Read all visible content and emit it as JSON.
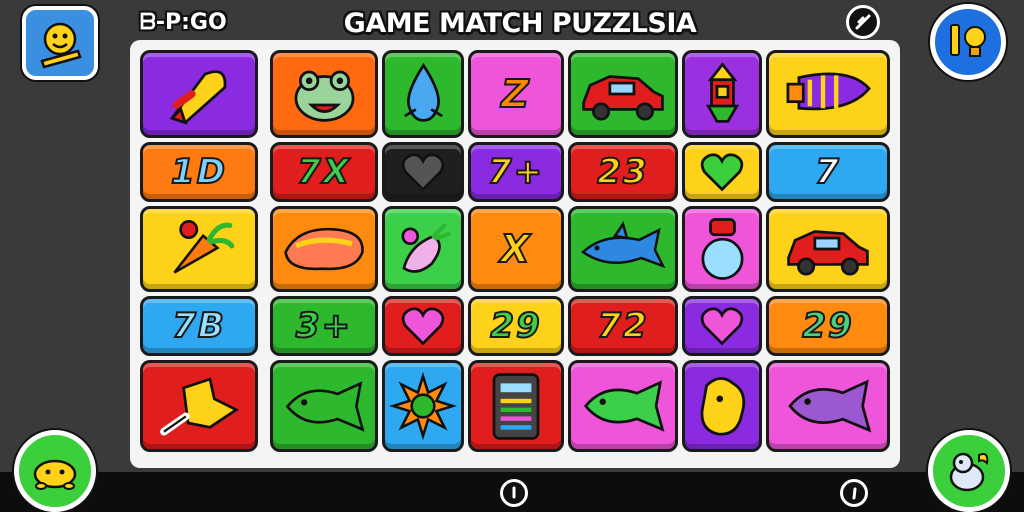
{
  "header": {
    "title": "GAME MATCH PUZZLSIA",
    "timer": "ᗷ-P:GO"
  },
  "buttons": {
    "avatar": "avatar-icon",
    "close": "close-icon",
    "hint": "lightbulb-hint-icon",
    "bottom_left": "turtle-icon",
    "bottom_right": "bird-icon"
  },
  "bottom_bar": {
    "left_indicator": "info-icon",
    "right_indicator": "info-icon"
  },
  "colors": {
    "purple": "#8a2be2",
    "orange": "#ff7a10",
    "green": "#2eb82e",
    "pink": "#ee55d8",
    "yellow": "#ffd21a",
    "red": "#e01e1e",
    "blue": "#2ea8f0",
    "dark": "#1f1f1f"
  },
  "grid": {
    "rows": [
      [
        {
          "kind": "icon",
          "icon": "rocket-icon",
          "color": "#8a2be2"
        },
        {
          "kind": "icon",
          "icon": "frog-face-icon",
          "color": "#ff6a10"
        },
        {
          "kind": "icon",
          "icon": "water-drop-icon",
          "color": "#2eb82e"
        },
        {
          "kind": "text",
          "text": "Z",
          "color": "#ee55d8",
          "fg": "#ff8a00"
        },
        {
          "kind": "icon",
          "icon": "car-icon",
          "color": "#2eb82e"
        },
        {
          "kind": "icon",
          "icon": "lantern-icon",
          "color": "#9b30e0"
        },
        {
          "kind": "icon",
          "icon": "spaceship-icon",
          "color": "#ffd21a"
        }
      ],
      [
        {
          "kind": "text",
          "text": "1D",
          "color": "#ff7a10",
          "fg": "#7ed2ff"
        },
        {
          "kind": "text",
          "text": "7X",
          "color": "#e01e1e",
          "fg": "#3ccf4a"
        },
        {
          "kind": "icon",
          "icon": "heart-icon",
          "color": "#1f1f1f"
        },
        {
          "kind": "text",
          "text": "7+",
          "color": "#8a2be2",
          "fg": "#ffd21a"
        },
        {
          "kind": "text",
          "text": "23",
          "color": "#e01e1e",
          "fg": "#ffd21a"
        },
        {
          "kind": "icon",
          "icon": "heart-icon",
          "color": "#ffd21a"
        },
        {
          "kind": "text",
          "text": "7",
          "color": "#2ea8f0",
          "fg": "#ffffff"
        }
      ],
      [
        {
          "kind": "icon",
          "icon": "carrot-icon",
          "color": "#ffd21a"
        },
        {
          "kind": "icon",
          "icon": "jellybean-icon",
          "color": "#ff8a10"
        },
        {
          "kind": "icon",
          "icon": "eggplant-icon",
          "color": "#3ccf4a"
        },
        {
          "kind": "text",
          "text": "X",
          "color": "#ff8a10",
          "fg": "#ffd21a"
        },
        {
          "kind": "icon",
          "icon": "shark-icon",
          "color": "#2eb82e"
        },
        {
          "kind": "icon",
          "icon": "potion-icon",
          "color": "#ee55d8"
        },
        {
          "kind": "icon",
          "icon": "car-icon",
          "color": "#ffd21a"
        }
      ],
      [
        {
          "kind": "text",
          "text": "7B",
          "color": "#2ea8f0",
          "fg": "#9adfff"
        },
        {
          "kind": "text",
          "text": "3+",
          "color": "#2eb82e",
          "fg": "#3ccf4a"
        },
        {
          "kind": "icon",
          "icon": "heart-icon",
          "color": "#e01e1e"
        },
        {
          "kind": "text",
          "text": "29",
          "color": "#ffd21a",
          "fg": "#3ccf4a"
        },
        {
          "kind": "text",
          "text": "72",
          "color": "#e01e1e",
          "fg": "#ffd21a"
        },
        {
          "kind": "icon",
          "icon": "heart-icon",
          "color": "#8a2be2"
        },
        {
          "kind": "text",
          "text": "29",
          "color": "#ff8a10",
          "fg": "#4ad080"
        }
      ],
      [
        {
          "kind": "icon",
          "icon": "star-block-icon",
          "color": "#e01e1e"
        },
        {
          "kind": "icon",
          "icon": "fish-icon",
          "color": "#2eb82e"
        },
        {
          "kind": "icon",
          "icon": "sun-icon",
          "color": "#2ea8f0"
        },
        {
          "kind": "icon",
          "icon": "radio-icon",
          "color": "#e01e1e"
        },
        {
          "kind": "icon",
          "icon": "fish-icon",
          "color": "#ee55d8"
        },
        {
          "kind": "icon",
          "icon": "cheese-icon",
          "color": "#8a2be2"
        },
        {
          "kind": "icon",
          "icon": "fish-icon",
          "color": "#ee55d8"
        }
      ]
    ]
  }
}
